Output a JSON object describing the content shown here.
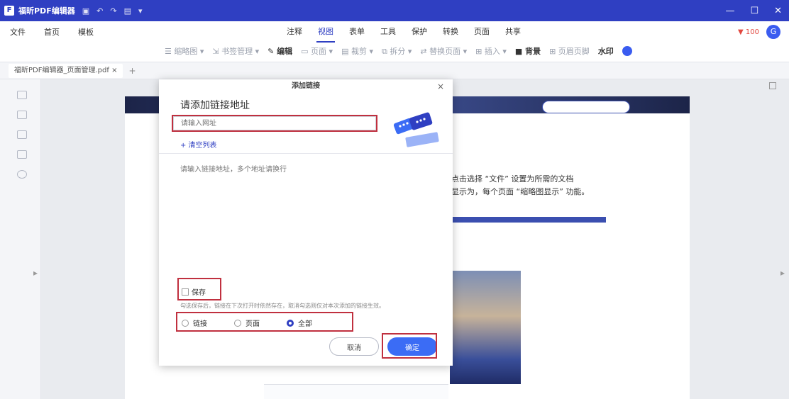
{
  "window": {
    "app_icon": "F",
    "app_name": "福昕PDF编辑器",
    "quick_access": [
      "▣",
      "↶",
      "↷",
      "▤",
      "▾"
    ],
    "controls": [
      "—",
      "☐",
      "✕"
    ]
  },
  "menubar": {
    "left_items": [
      "文件",
      "首页",
      "模板"
    ],
    "tabs": [
      "注释",
      "视图",
      "表单",
      "工具",
      "保护",
      "转换",
      "页面",
      "共享"
    ],
    "active_tab_index": 1,
    "badge": "▼ 100",
    "avatar": "G"
  },
  "toolbar": {
    "tools": [
      "☰ 缩略图 ▾",
      "⇲ 书签管理 ▾",
      "✎ 编辑",
      "▭ 页面 ▾",
      "▤ 裁剪 ▾",
      "⧉ 拆分 ▾",
      "⇄ 替换页面 ▾",
      "⊞ 插入 ▾"
    ],
    "bold_tools": [
      "■ 背景",
      "⊞ 页眉页脚",
      "水印"
    ]
  },
  "doc_tab": {
    "label": "福昕PDF编辑器_页面管理.pdf",
    "close": "×",
    "add": "+"
  },
  "page": {
    "text_line1": "点击选择 “文件” 设置为所需的文档",
    "text_line2": "显示为，每个页面 “缩略图显示” 功能。"
  },
  "dialog": {
    "title": "添加链接",
    "close": "×",
    "heading": "请添加链接地址",
    "url_placeholder": "请输入网址",
    "clear_label": "+ 清空列表",
    "textarea_placeholder": "请输入链接地址，多个地址请换行",
    "checkbox_label": "保存",
    "hint": "勾选保存后，链接在下次打开时依然存在，取消勾选则仅对本次添加的链接生效。",
    "radio_options": [
      "链接",
      "页面",
      "全部"
    ],
    "radio_selected": 2,
    "cancel": "取消",
    "ok": "确定"
  }
}
